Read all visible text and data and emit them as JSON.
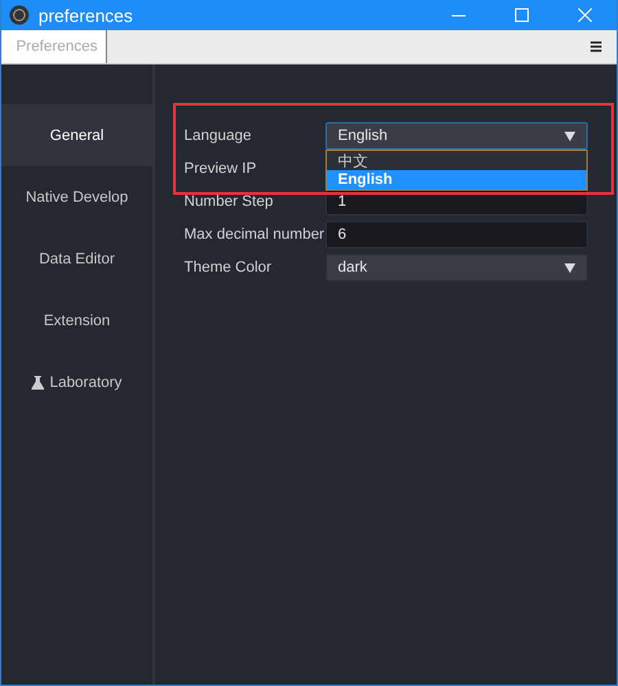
{
  "window": {
    "title": "preferences"
  },
  "tabs": [
    {
      "label": "Preferences",
      "selected": true
    }
  ],
  "sidebar": {
    "items": [
      {
        "label": "General",
        "selected": true,
        "kind": "plain"
      },
      {
        "label": "Native Develop",
        "selected": false,
        "kind": "plain"
      },
      {
        "label": "Data Editor",
        "selected": false,
        "kind": "plain"
      },
      {
        "label": "Extension",
        "selected": false,
        "kind": "plain"
      },
      {
        "label": "Laboratory",
        "selected": false,
        "kind": "lab"
      }
    ]
  },
  "settings": [
    {
      "label": "Language",
      "kind": "select",
      "value": "English",
      "expanded": true,
      "options": [
        {
          "label": "中文",
          "selected": false
        },
        {
          "label": "English",
          "selected": true
        }
      ]
    },
    {
      "label": "Preview IP"
    },
    {
      "label": "Number Step",
      "kind": "input",
      "value": "1"
    },
    {
      "label": "Max decimal number",
      "kind": "input",
      "value": "6"
    },
    {
      "label": "Theme Color",
      "kind": "select",
      "value": "dark",
      "expanded": false
    }
  ]
}
